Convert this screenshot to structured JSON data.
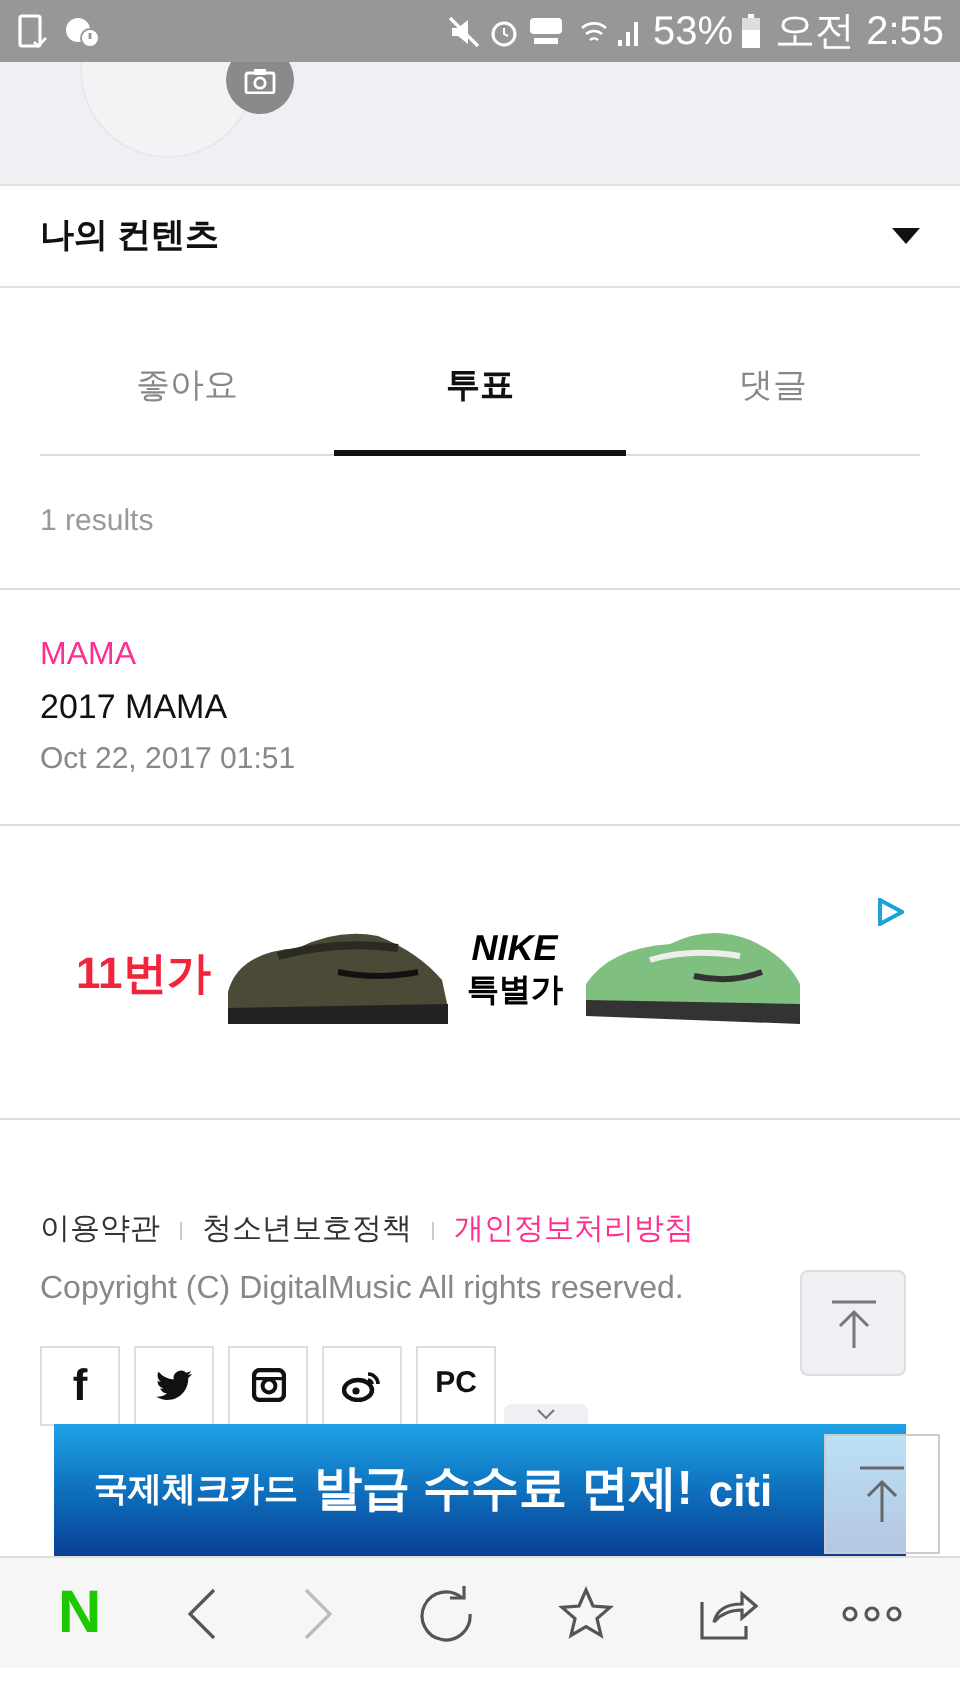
{
  "status_bar": {
    "battery": "53%",
    "time": "오전 2:55"
  },
  "section": {
    "title": "나의 컨텐츠",
    "expanded": false
  },
  "tabs": [
    {
      "label": "좋아요",
      "selected": false
    },
    {
      "label": "투표",
      "selected": true
    },
    {
      "label": "댓글",
      "selected": false
    }
  ],
  "results_count": "1 results",
  "items": [
    {
      "category": "MAMA",
      "title": "2017 MAMA",
      "date": "Oct 22, 2017 01:51"
    }
  ],
  "ad": {
    "brand": "11번가",
    "logo": "NIKE",
    "tagline": "특별가"
  },
  "footer": {
    "links": [
      {
        "label": "이용약관",
        "highlight": false
      },
      {
        "label": "청소년보호정책",
        "highlight": false
      },
      {
        "label": "개인정보처리방침",
        "highlight": true
      }
    ],
    "copyright": "Copyright (C) DigitalMusic All rights reserved.",
    "social": [
      {
        "kind": "facebook",
        "label": "f"
      },
      {
        "kind": "twitter"
      },
      {
        "kind": "instagram"
      },
      {
        "kind": "weibo"
      },
      {
        "kind": "pc",
        "label": "PC"
      }
    ]
  },
  "banner": {
    "small": "국제체크카드",
    "big": "발급 수수료 면제!",
    "brand": "citi"
  },
  "browser_bar": {
    "logo": "N"
  }
}
